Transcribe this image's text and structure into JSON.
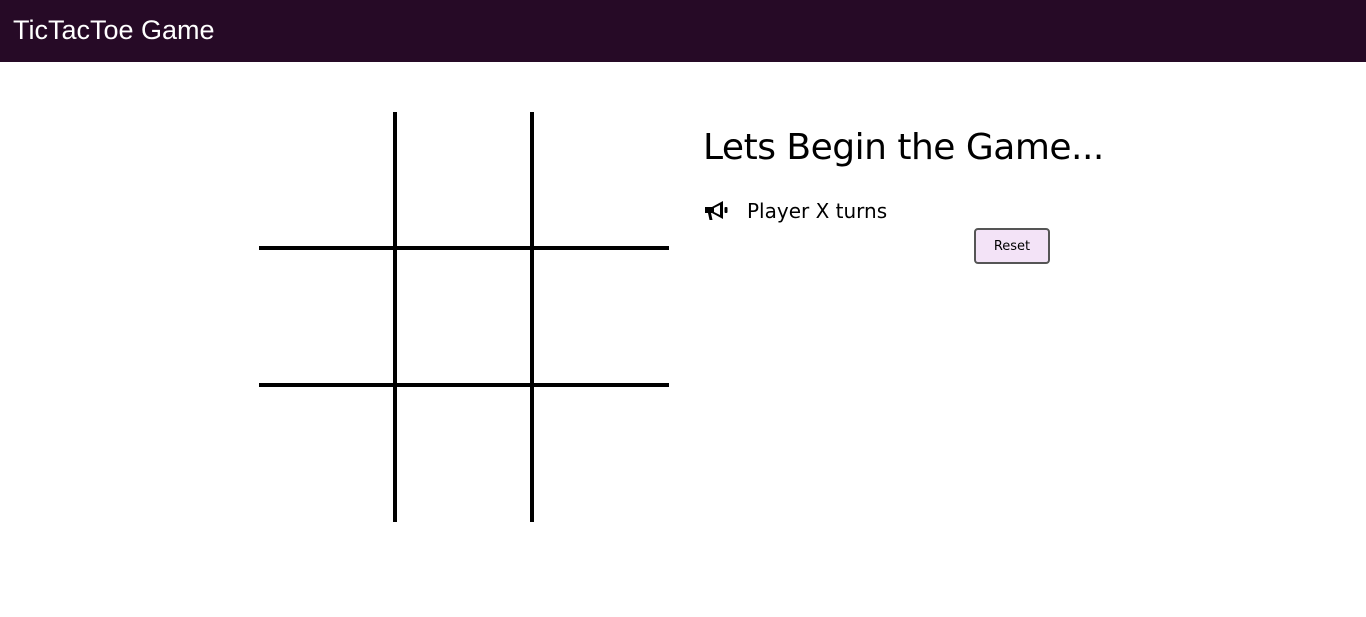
{
  "navbar": {
    "brand": "TicTacToe Game",
    "background": "#260a26"
  },
  "board": {
    "cells": [
      "",
      "",
      "",
      "",
      "",
      "",
      "",
      "",
      ""
    ]
  },
  "status": {
    "title": "Lets Begin the Game...",
    "turn_icon": "megaphone-icon",
    "turn_text": "Player X turns"
  },
  "controls": {
    "reset_label": "Reset",
    "reset_background": "#f3e3f7"
  }
}
